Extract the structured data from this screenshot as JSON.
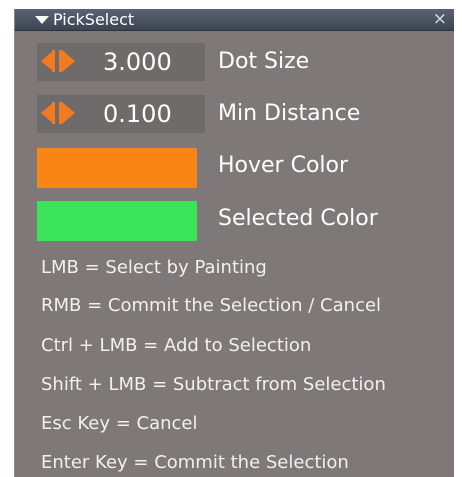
{
  "panel": {
    "title": "PickSelect",
    "close_glyph": "×"
  },
  "params": {
    "dot_size": {
      "value": "3.000",
      "label": "Dot Size"
    },
    "min_distance": {
      "value": "0.100",
      "label": "Min Distance"
    }
  },
  "colors": {
    "hover": {
      "label": "Hover Color",
      "hex": "#f88516"
    },
    "selected": {
      "label": "Selected Color",
      "hex": "#3ae35a"
    }
  },
  "help": [
    "LMB = Select by Painting",
    "RMB = Commit the Selection / Cancel",
    "Ctrl + LMB = Add to Selection",
    "Shift + LMB = Subtract from Selection",
    "Esc Key = Cancel",
    "Enter Key = Commit the Selection"
  ],
  "icons": {
    "collapse": "triangle-down-icon",
    "close": "close-icon",
    "decrement": "arrow-left-icon",
    "increment": "arrow-right-icon"
  }
}
